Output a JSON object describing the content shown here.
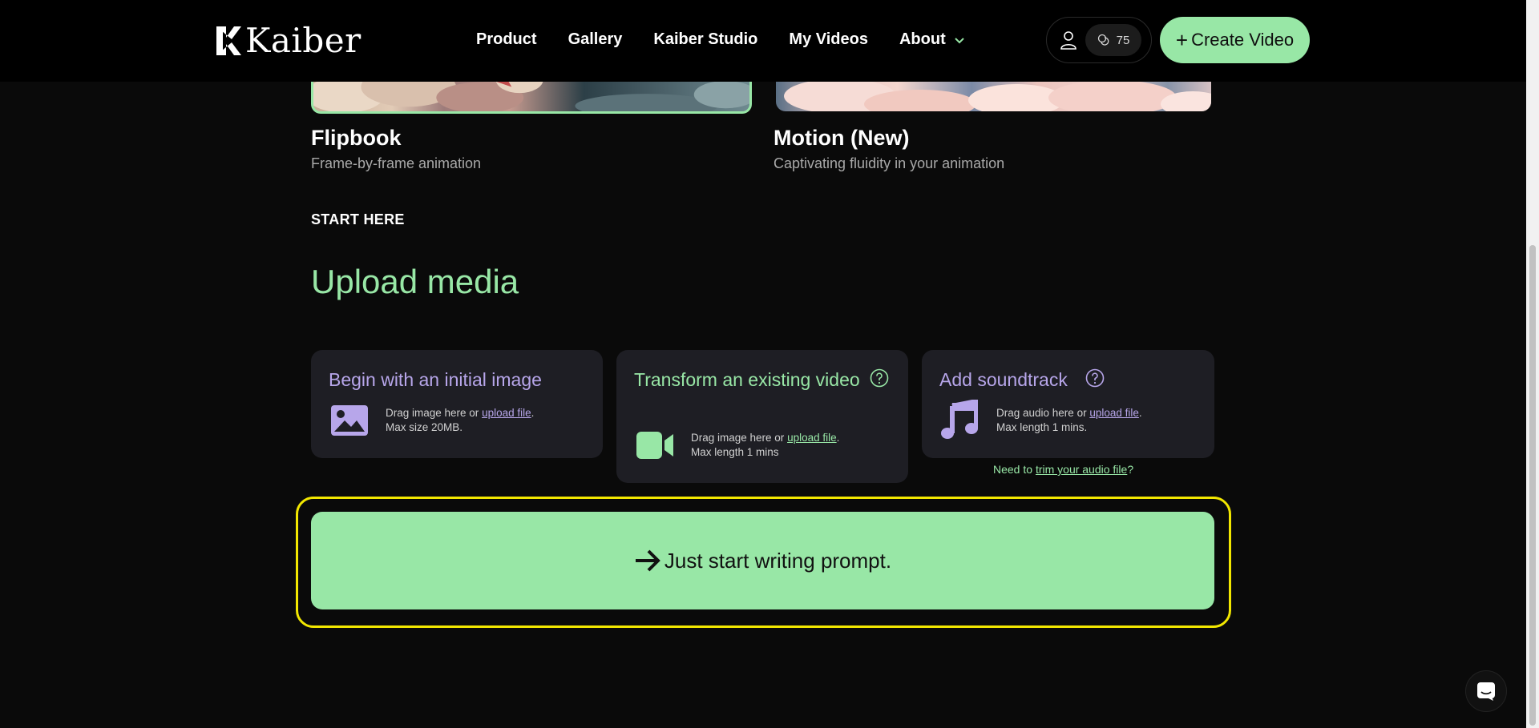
{
  "header": {
    "logo_text": "Kaiber",
    "nav": [
      {
        "label": "Product"
      },
      {
        "label": "Gallery"
      },
      {
        "label": "Kaiber Studio"
      },
      {
        "label": "My Videos"
      },
      {
        "label": "About"
      }
    ],
    "credits": "75",
    "create_label": "Create Video",
    "create_plus": "+"
  },
  "styles": {
    "flipbook": {
      "title": "Flipbook",
      "subtitle": "Frame-by-frame animation"
    },
    "motion": {
      "title": "Motion (New)",
      "subtitle": "Captivating fluidity in your animation"
    }
  },
  "start_here": "START HERE",
  "upload_title": "Upload media",
  "panels": {
    "image": {
      "title": "Begin with an initial image",
      "drag_text": "Drag image here or ",
      "link": "upload file",
      "dot": ".",
      "limit": "Max size 20MB."
    },
    "video": {
      "title": "Transform an existing video",
      "drag_text": "Drag image here or ",
      "link": "upload file",
      "dot": ".",
      "limit": "Max length 1 mins"
    },
    "audio": {
      "title": "Add soundtrack",
      "drag_text": "Drag audio here or ",
      "link": "upload file",
      "dot": ".",
      "limit": "Max length 1 mins."
    }
  },
  "trim": {
    "prefix": "Need to ",
    "link": "trim your audio file",
    "suffix": "?"
  },
  "prompt_button": "Just start writing prompt.",
  "colors": {
    "accent_green": "#98e7a6",
    "accent_purple": "#b7a6ea",
    "highlight_yellow": "#f2e700",
    "panel_bg": "#1e1e24"
  }
}
